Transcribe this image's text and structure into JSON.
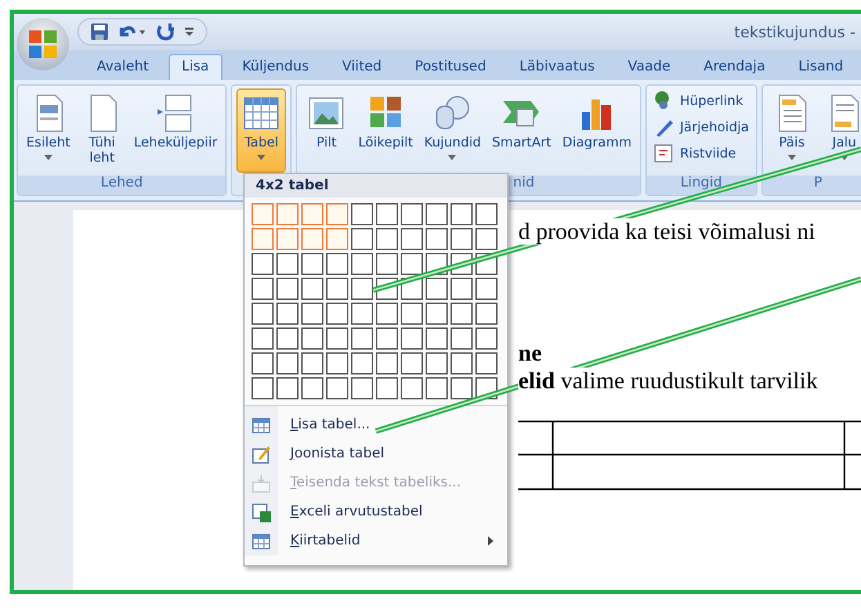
{
  "window": {
    "title": "tekstikujundus - "
  },
  "tabs": [
    {
      "label": "Avaleht",
      "selected": false
    },
    {
      "label": "Lisa",
      "selected": true
    },
    {
      "label": "Küljendus",
      "selected": false
    },
    {
      "label": "Viited",
      "selected": false
    },
    {
      "label": "Postitused",
      "selected": false
    },
    {
      "label": "Läbivaatus",
      "selected": false
    },
    {
      "label": "Vaade",
      "selected": false
    },
    {
      "label": "Arendaja",
      "selected": false
    },
    {
      "label": "Lisand",
      "selected": false
    }
  ],
  "ribbon_groups": [
    {
      "label": "Lehed",
      "items": [
        {
          "kind": "large",
          "label": "Esileht",
          "dropdown": true,
          "selected": false
        },
        {
          "kind": "large",
          "label": "Tühi leht",
          "dropdown": false,
          "selected": false
        },
        {
          "kind": "large",
          "label": "Leheküljepiir",
          "dropdown": false,
          "selected": false
        }
      ]
    },
    {
      "items": [
        {
          "kind": "large",
          "label": "Tabel",
          "dropdown": true,
          "selected": true
        }
      ]
    },
    {
      "label": "nid",
      "items": [
        {
          "kind": "large",
          "label": "Pilt",
          "dropdown": false,
          "selected": false
        },
        {
          "kind": "large",
          "label": "Lõikepilt",
          "dropdown": false,
          "selected": false
        },
        {
          "kind": "large",
          "label": "Kujundid",
          "dropdown": true,
          "selected": false
        },
        {
          "kind": "large",
          "label": "SmartArt",
          "dropdown": false,
          "selected": false
        },
        {
          "kind": "large",
          "label": "Diagramm",
          "dropdown": false,
          "selected": false
        }
      ]
    },
    {
      "label": "Lingid",
      "items": [
        {
          "kind": "small",
          "label": "Hüperlink"
        },
        {
          "kind": "small",
          "label": "Järjehoidja"
        },
        {
          "kind": "small",
          "label": "Ristviide"
        }
      ]
    },
    {
      "label": "P",
      "items": [
        {
          "kind": "large",
          "label": "Päis",
          "dropdown": true,
          "selected": false
        },
        {
          "kind": "large",
          "label": "Jalu",
          "dropdown": true,
          "selected": false
        }
      ]
    }
  ],
  "table_menu": {
    "title": "4x2 tabel",
    "grid": [
      {
        "cells": [
          {
            "selected": true
          },
          {
            "selected": true
          },
          {
            "selected": true
          },
          {
            "selected": true
          },
          {
            "selected": false
          },
          {
            "selected": false
          },
          {
            "selected": false
          },
          {
            "selected": false
          },
          {
            "selected": false
          },
          {
            "selected": false
          }
        ]
      },
      {
        "cells": [
          {
            "selected": true
          },
          {
            "selected": true
          },
          {
            "selected": true
          },
          {
            "selected": true
          },
          {
            "selected": false
          },
          {
            "selected": false
          },
          {
            "selected": false
          },
          {
            "selected": false
          },
          {
            "selected": false
          },
          {
            "selected": false
          }
        ]
      },
      {
        "cells": [
          {
            "selected": false
          },
          {
            "selected": false
          },
          {
            "selected": false
          },
          {
            "selected": false
          },
          {
            "selected": false
          },
          {
            "selected": false
          },
          {
            "selected": false
          },
          {
            "selected": false
          },
          {
            "selected": false
          },
          {
            "selected": false
          }
        ]
      },
      {
        "cells": [
          {
            "selected": false
          },
          {
            "selected": false
          },
          {
            "selected": false
          },
          {
            "selected": false
          },
          {
            "selected": false
          },
          {
            "selected": false
          },
          {
            "selected": false
          },
          {
            "selected": false
          },
          {
            "selected": false
          },
          {
            "selected": false
          }
        ]
      },
      {
        "cells": [
          {
            "selected": false
          },
          {
            "selected": false
          },
          {
            "selected": false
          },
          {
            "selected": false
          },
          {
            "selected": false
          },
          {
            "selected": false
          },
          {
            "selected": false
          },
          {
            "selected": false
          },
          {
            "selected": false
          },
          {
            "selected": false
          }
        ]
      },
      {
        "cells": [
          {
            "selected": false
          },
          {
            "selected": false
          },
          {
            "selected": false
          },
          {
            "selected": false
          },
          {
            "selected": false
          },
          {
            "selected": false
          },
          {
            "selected": false
          },
          {
            "selected": false
          },
          {
            "selected": false
          },
          {
            "selected": false
          }
        ]
      },
      {
        "cells": [
          {
            "selected": false
          },
          {
            "selected": false
          },
          {
            "selected": false
          },
          {
            "selected": false
          },
          {
            "selected": false
          },
          {
            "selected": false
          },
          {
            "selected": false
          },
          {
            "selected": false
          },
          {
            "selected": false
          },
          {
            "selected": false
          }
        ]
      },
      {
        "cells": [
          {
            "selected": false
          },
          {
            "selected": false
          },
          {
            "selected": false
          },
          {
            "selected": false
          },
          {
            "selected": false
          },
          {
            "selected": false
          },
          {
            "selected": false
          },
          {
            "selected": false
          },
          {
            "selected": false
          },
          {
            "selected": false
          }
        ]
      }
    ],
    "items": [
      {
        "label": "Lisa tabel...",
        "disabled": false,
        "submenu": false
      },
      {
        "label": "Joonista tabel",
        "disabled": false,
        "submenu": false
      },
      {
        "label": "Teisenda tekst tabeliks...",
        "disabled": true,
        "submenu": false
      },
      {
        "label": "Exceli arvutustabel",
        "disabled": false,
        "submenu": false
      },
      {
        "label": "Kiirtabelid",
        "disabled": false,
        "submenu": true
      }
    ]
  },
  "document": [
    {
      "kind": "paragraph",
      "text": "d proovida ka teisi võimalusi ni"
    },
    {
      "kind": "heading",
      "text": "ne"
    },
    {
      "kind": "paragraph",
      "text": "**elid** valime ruudustikult tarvilik"
    }
  ]
}
